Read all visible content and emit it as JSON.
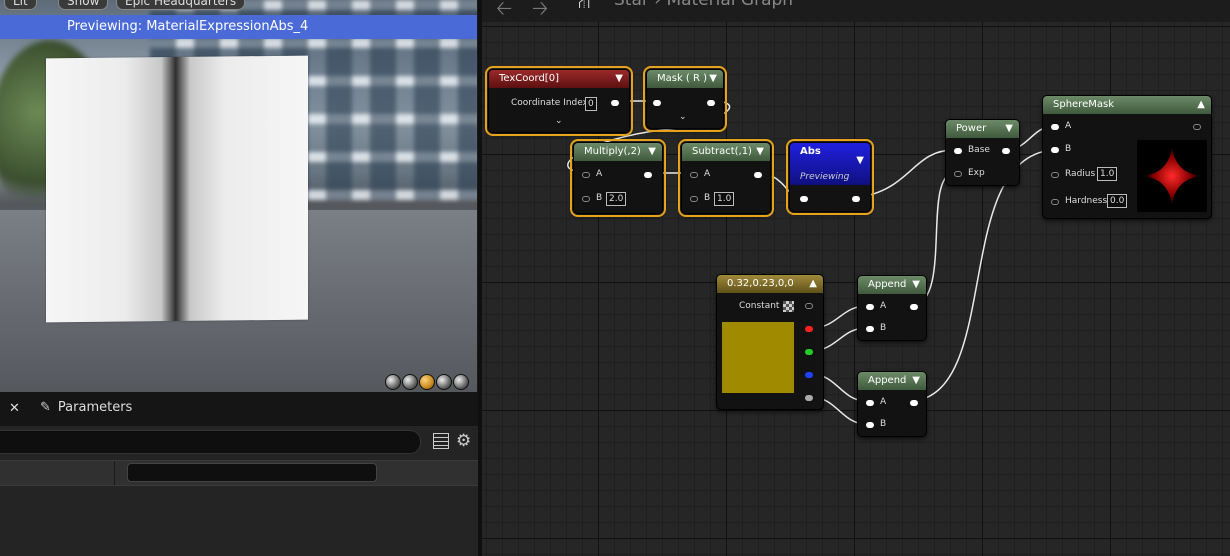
{
  "viewport": {
    "lit_label": "Lit",
    "show_label": "Show",
    "sky_label": "Epic Headquarters",
    "preview_banner": "Previewing: MaterialExpressionAbs_4"
  },
  "params_panel": {
    "close_glyph": "✕",
    "tab_label": "Parameters",
    "pen_icon": "✎",
    "gear_icon": "⚙"
  },
  "graph_header": {
    "back_glyph": "🡠",
    "fwd_glyph": "🡢",
    "crumb_icon": "⛙",
    "breadcrumb": "Star  ›  Material Graph"
  },
  "nodes": {
    "texcoord": {
      "title": "TexCoord[0]",
      "coord_label": "Coordinate Index",
      "coord_value": "0"
    },
    "mask": {
      "title": "Mask ( R )"
    },
    "multiply": {
      "title": "Multiply(,2)",
      "a": "A",
      "b": "B",
      "b_value": "2.0"
    },
    "subtract": {
      "title": "Subtract(,1)",
      "a": "A",
      "b": "B",
      "b_value": "1.0"
    },
    "abs": {
      "title": "Abs",
      "sub": "Previewing"
    },
    "power": {
      "title": "Power",
      "base": "Base",
      "exp": "Exp"
    },
    "spheremask": {
      "title": "SphereMask",
      "a": "A",
      "b": "B",
      "radius": "Radius",
      "radius_value": "1.0",
      "hardness": "Hardness",
      "hardness_value": "0.0"
    },
    "constant": {
      "title": "0.32,0.23,0,0",
      "label": "Constant",
      "color": "#a08a00"
    },
    "append1": {
      "title": "Append",
      "a": "A",
      "b": "B"
    },
    "append2": {
      "title": "Append",
      "a": "A",
      "b": "B"
    }
  },
  "colors": {
    "selection": "#e6a21b",
    "abs_header": "#1a1ad0",
    "preview_banner": "#4a6ad8"
  }
}
